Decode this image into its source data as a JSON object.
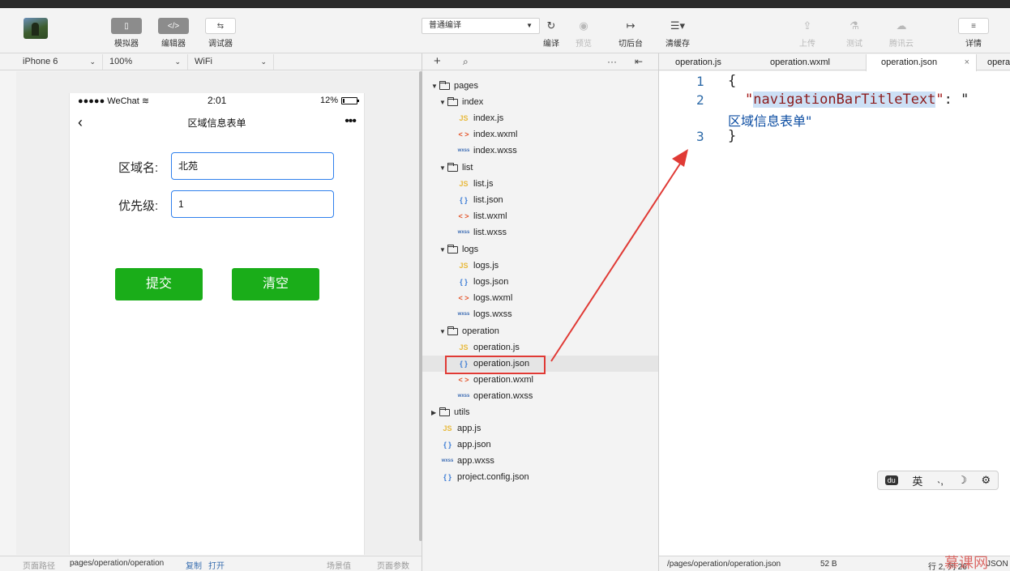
{
  "toolbar": {
    "simulator": "模拟器",
    "editor": "编辑器",
    "debugger": "调试器",
    "compile_mode": "普通编译",
    "compile": "编译",
    "preview": "预览",
    "background": "切后台",
    "clear_cache": "清缓存",
    "upload": "上传",
    "test": "测试",
    "cloud": "腾讯云",
    "details": "详情"
  },
  "sim": {
    "device": "iPhone 6",
    "zoom": "100%",
    "network": "WiFi"
  },
  "phone": {
    "carrier": "●●●●● WeChat",
    "time": "2:01",
    "battery": "12%",
    "nav_title": "区域信息表单",
    "field1_label": "区域名:",
    "field1_value": "北苑",
    "field2_label": "优先级:",
    "field2_value": "1",
    "submit": "提交",
    "clear": "清空"
  },
  "sim_footer": {
    "path_label": "页面路径",
    "path": "pages/operation/operation",
    "copy": "复制",
    "open": "打开",
    "scene": "场景值",
    "params": "页面参数"
  },
  "tree": {
    "pages": "pages",
    "index": "index",
    "index_js": "index.js",
    "index_wxml": "index.wxml",
    "index_wxss": "index.wxss",
    "list": "list",
    "list_js": "list.js",
    "list_json": "list.json",
    "list_wxml": "list.wxml",
    "list_wxss": "list.wxss",
    "logs": "logs",
    "logs_js": "logs.js",
    "logs_json": "logs.json",
    "logs_wxml": "logs.wxml",
    "logs_wxss": "logs.wxss",
    "operation": "operation",
    "op_js": "operation.js",
    "op_json": "operation.json",
    "op_wxml": "operation.wxml",
    "op_wxss": "operation.wxss",
    "utils": "utils",
    "app_js": "app.js",
    "app_json": "app.json",
    "app_wxss": "app.wxss",
    "project_config": "project.config.json",
    "icons": {
      "js": "JS",
      "json": "{ }",
      "wxml": "< >",
      "wxss": "wxss"
    }
  },
  "tabs": {
    "t1": "operation.js",
    "t2": "operation.wxml",
    "t3": "operation.json",
    "t4": "opera"
  },
  "code": {
    "ln1": "1",
    "ln2": "2",
    "ln3": "3",
    "open_brace": "{",
    "key": "navigationBarTitleText",
    "colon": ": \"",
    "value": "区域信息表单\"",
    "close_brace": "}"
  },
  "ime": {
    "du": "du",
    "lang": "英"
  },
  "editor_footer": {
    "path": "/pages/operation/operation.json",
    "size": "52 B",
    "position": "行 2, 列 26",
    "lang": "JSON"
  },
  "watermark": "慕课网",
  "colors": {
    "primary_green": "#1aad19",
    "input_border": "#2f80ed",
    "highlight_red": "#e03a35"
  }
}
